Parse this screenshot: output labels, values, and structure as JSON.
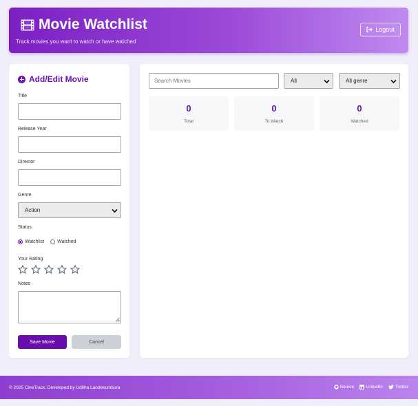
{
  "header": {
    "title": "Movie Watchlist",
    "subtitle": "Track movies you want to watch or have watched",
    "logout_label": "Logout",
    "title_icon": "film-icon",
    "logout_icon": "sign-out-icon"
  },
  "form": {
    "title": "Add/Edit Movie",
    "title_icon": "plus-circle-icon",
    "title_label": "Title",
    "title_value": "",
    "year_label": "Release Year",
    "year_value": "",
    "director_label": "Director",
    "director_value": "",
    "genre_label": "Genre",
    "genre_value": "Action",
    "status_label": "Status",
    "status_options": [
      "Watchlist",
      "Watched"
    ],
    "status_selected": "Watchlist",
    "rating_label": "Your Rating",
    "rating_value": 0,
    "rating_max": 5,
    "notes_label": "Notes",
    "notes_value": "",
    "save_label": "Save Movie",
    "cancel_label": "Cancel"
  },
  "list": {
    "search_placeholder": "Search Movies",
    "status_filter": "All",
    "genre_filter": "All genre",
    "stats": [
      {
        "value": "0",
        "label": "Total"
      },
      {
        "value": "0",
        "label": "To Watch"
      },
      {
        "value": "0",
        "label": "Watched"
      }
    ]
  },
  "footer": {
    "copyright": "© 2025 CineTrack. Developed by Uditha Landekumbura",
    "links": [
      {
        "label": "Source",
        "icon": "github-icon"
      },
      {
        "label": "LinkedIn",
        "icon": "linkedin-icon"
      },
      {
        "label": "Twitter",
        "icon": "twitter-icon"
      }
    ]
  },
  "colors": {
    "accent": "#6a12b3",
    "header_start": "#7b1fc2",
    "header_end": "#c08af0",
    "background": "#f1eefb"
  }
}
